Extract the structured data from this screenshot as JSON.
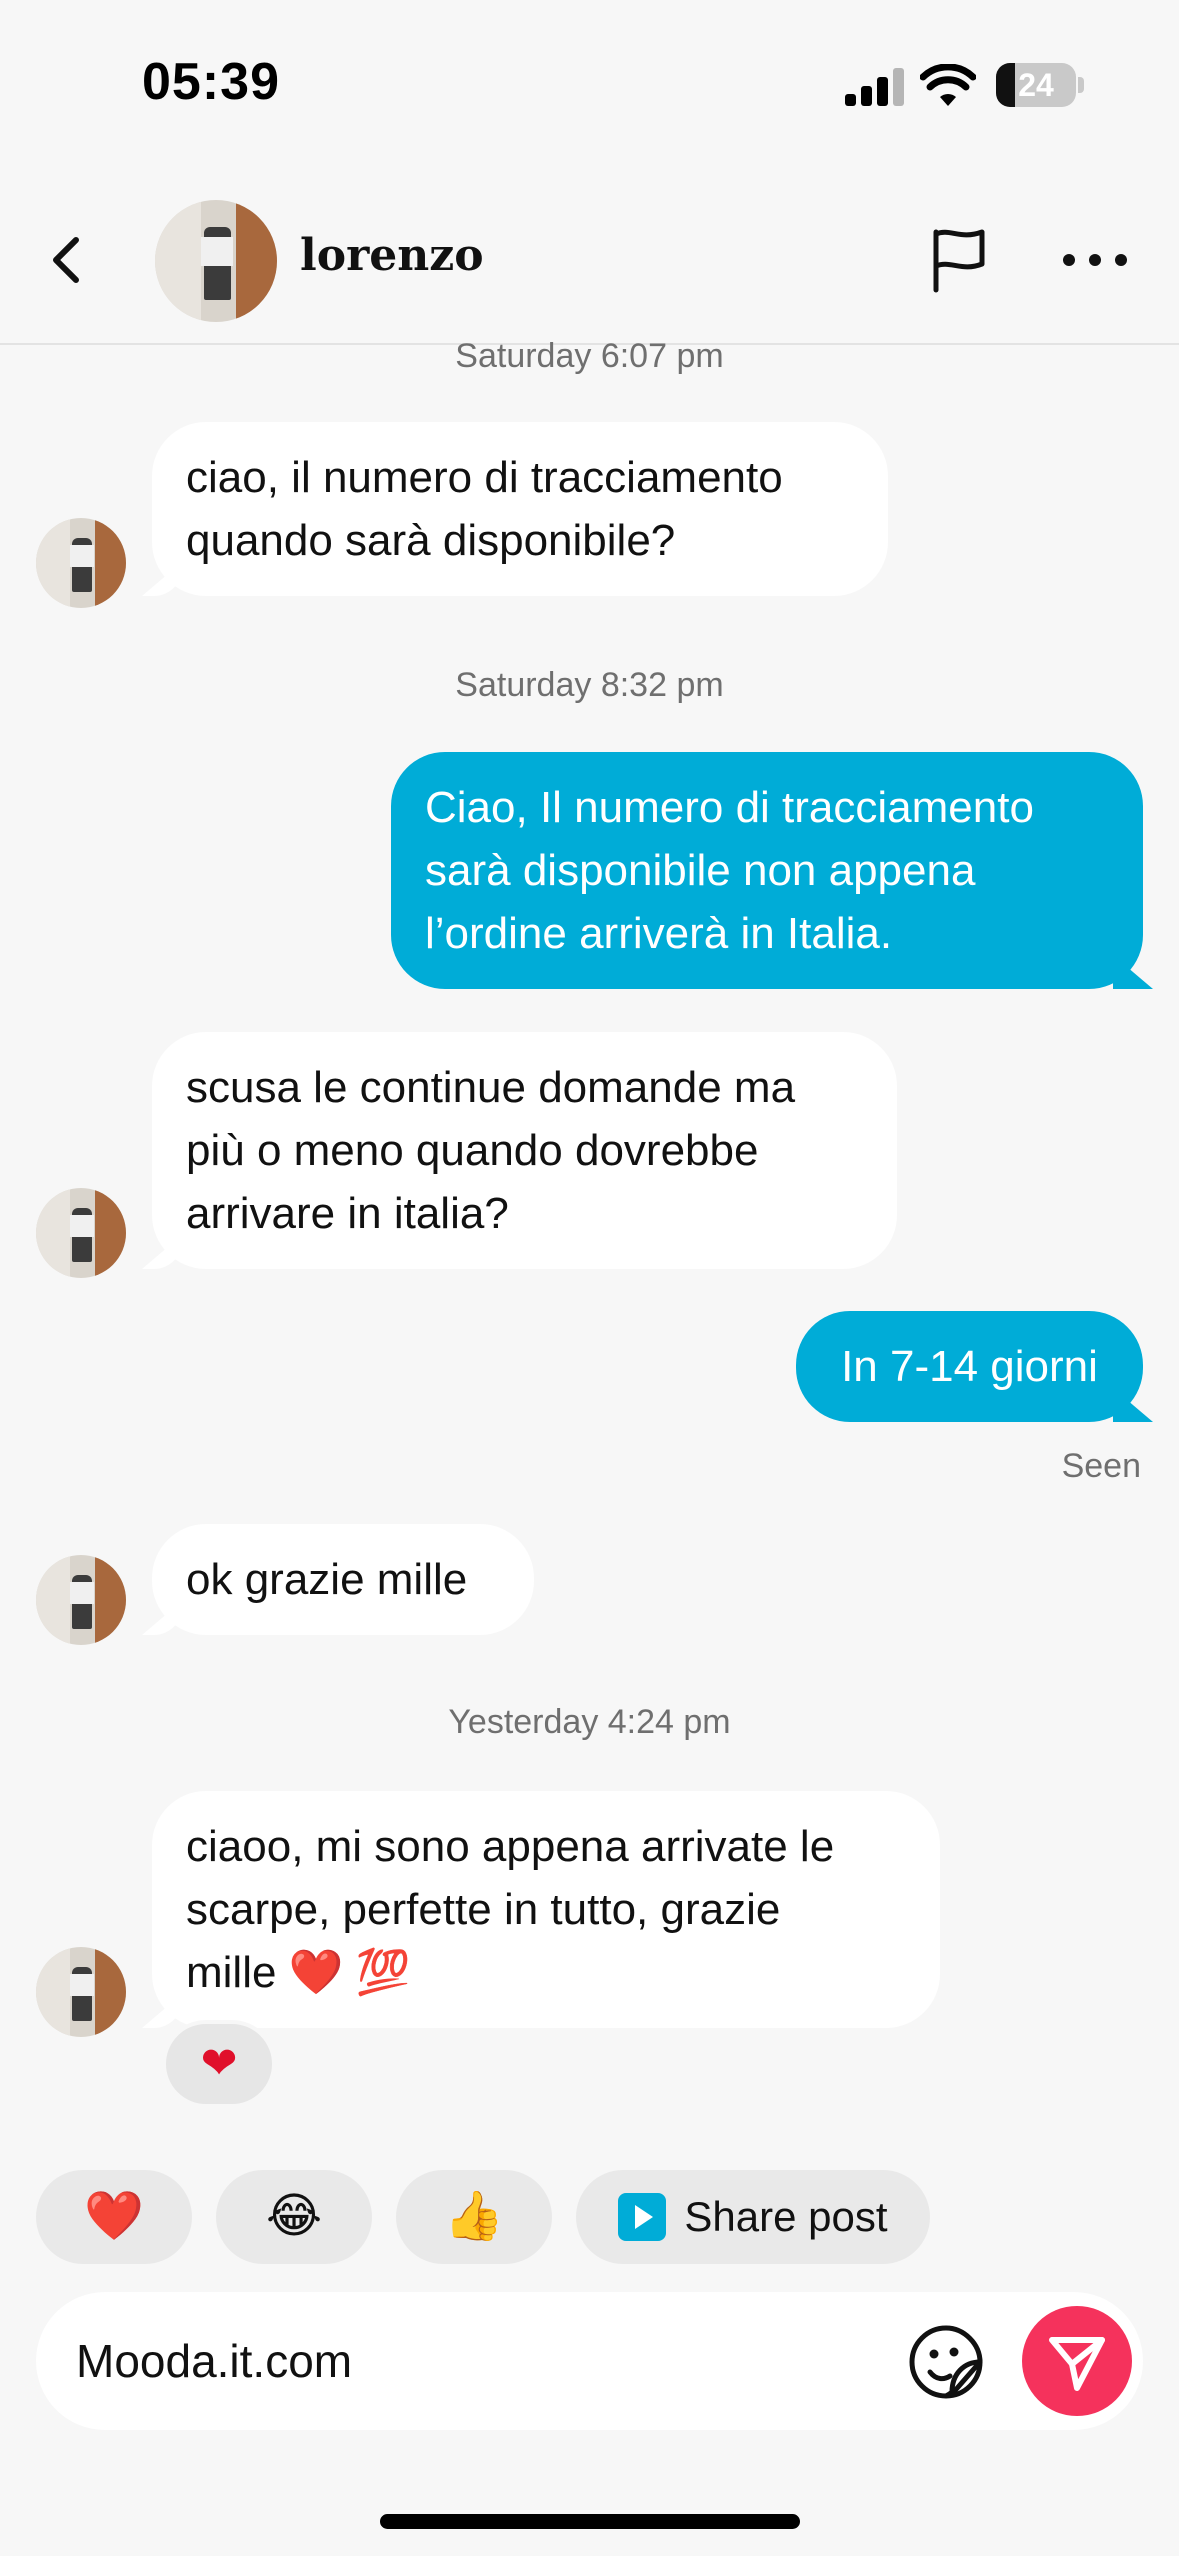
{
  "status_bar": {
    "time": "05:39",
    "battery": "24"
  },
  "header": {
    "contact_name": "lorenzo",
    "icons": [
      "back-arrow-icon",
      "flag-icon",
      "more-icon"
    ]
  },
  "messages": [
    {
      "type": "timestamp",
      "text": "Saturday 6:07 pm"
    },
    {
      "type": "incoming",
      "text": "ciao, il numero di tracciamento\nquando sarà disponibile?"
    },
    {
      "type": "timestamp",
      "text": "Saturday 8:32 pm"
    },
    {
      "type": "outgoing",
      "text": "Ciao, Il numero di tracciamento\nsarà disponibile non appena\nl’ordine arriverà in Italia."
    },
    {
      "type": "incoming",
      "text": "scusa le continue domande ma\npiù o meno quando dovrebbe\narrivare in italia?"
    },
    {
      "type": "outgoing",
      "text": "In 7-14 giorni"
    },
    {
      "type": "status",
      "text": "Seen"
    },
    {
      "type": "incoming",
      "text": "ok grazie mille"
    },
    {
      "type": "timestamp",
      "text": "Yesterday 4:24 pm"
    },
    {
      "type": "incoming",
      "text": "ciaoo, mi sono appena arrivate le\nscarpe, perfette in tutto, grazie\nmille ❤️ 💯",
      "reaction": "❤"
    }
  ],
  "quick_replies": [
    {
      "label": "❤️",
      "icon": "heart-emoji"
    },
    {
      "label": "😂",
      "icon": "laughing-emoji"
    },
    {
      "label": "👍",
      "icon": "thumbs-up-emoji"
    },
    {
      "label": "Share post",
      "icon": "share-post-icon"
    }
  ],
  "composer": {
    "value": "Mooda.it.com",
    "icons": [
      "sticker-icon",
      "send-icon"
    ],
    "send_color": "#f5325c"
  },
  "colors": {
    "background": "#f7f7f7",
    "outgoing_bubble": "#00acd7",
    "incoming_bubble": "#ffffff"
  }
}
